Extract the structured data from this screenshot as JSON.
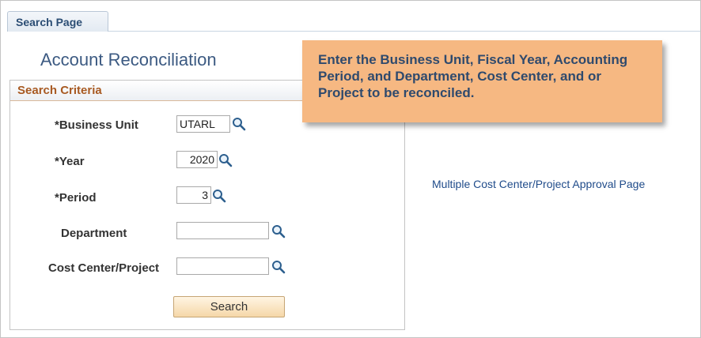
{
  "tab": {
    "label": "Search Page"
  },
  "page": {
    "title": "Account Reconciliation"
  },
  "criteria": {
    "header": "Search Criteria",
    "fields": [
      {
        "label": "*Business Unit",
        "value": "UTARL",
        "lookup_icon": "magnifier-icon"
      },
      {
        "label": "*Year",
        "value": "2020",
        "lookup_icon": "magnifier-icon"
      },
      {
        "label": "*Period",
        "value": "3",
        "lookup_icon": "magnifier-icon"
      },
      {
        "label": "Department",
        "value": "",
        "lookup_icon": "magnifier-icon"
      },
      {
        "label": "Cost Center/Project",
        "value": "",
        "lookup_icon": "magnifier-icon"
      }
    ],
    "search_label": "Search"
  },
  "callout": {
    "text": "Enter the Business Unit, Fiscal Year, Accounting Period, and Department, Cost Center, and or Project to be reconciled."
  },
  "links": {
    "approval": "Multiple Cost Center/Project Approval Page"
  },
  "colors": {
    "callout_bg": "#f6b882",
    "callout_text": "#2f4a6d",
    "section_header_text": "#a85a22",
    "title_text": "#3c5a82",
    "link": "#1f4b8a"
  }
}
